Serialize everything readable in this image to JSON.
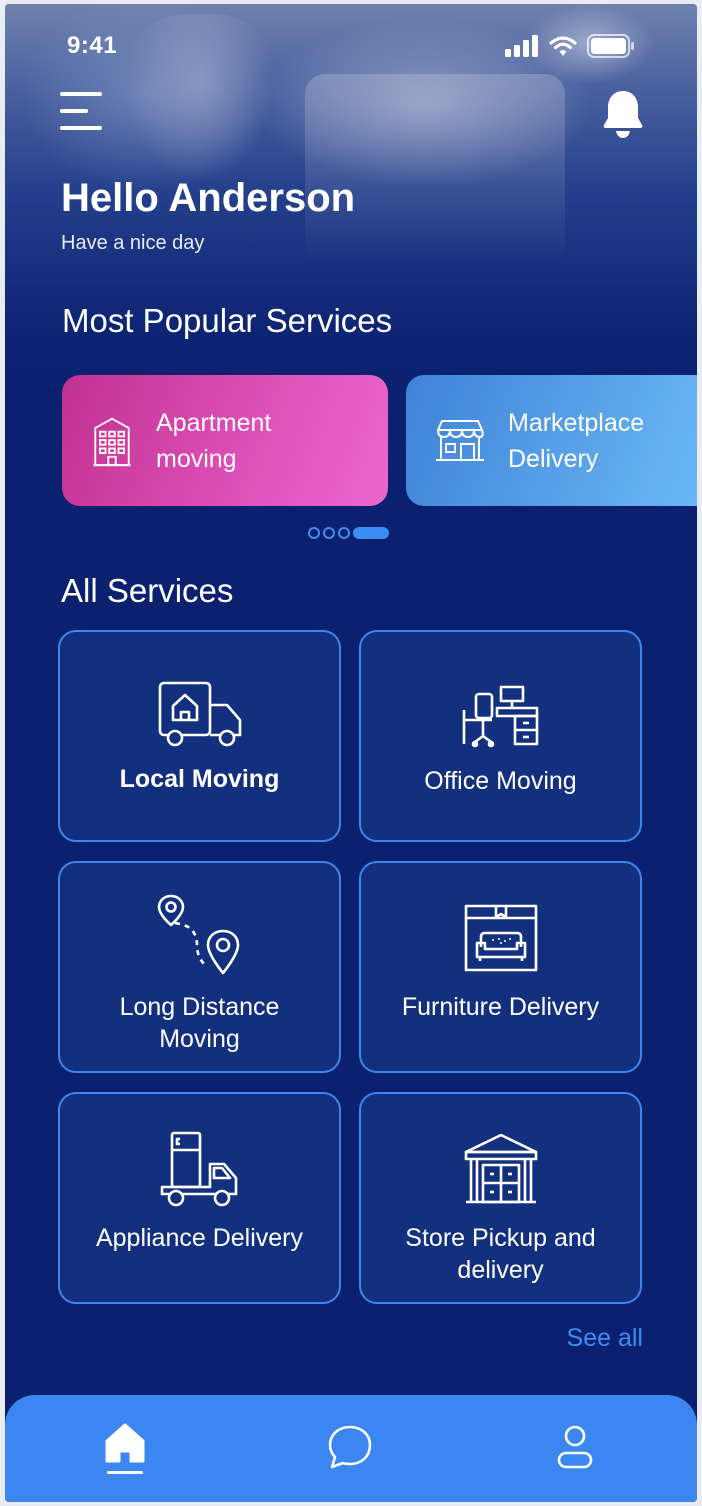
{
  "status_bar": {
    "time": "9:41"
  },
  "header": {
    "greeting": "Hello Anderson",
    "subtitle": "Have a nice day"
  },
  "popular": {
    "title": "Most Popular Services",
    "items": [
      {
        "line1": "Apartment",
        "line2": "moving",
        "icon": "building-icon"
      },
      {
        "line1": "Marketplace",
        "line2": "Delivery",
        "icon": "storefront-icon"
      }
    ],
    "carousel_pages": 4,
    "active_page": 4
  },
  "all_services": {
    "title": "All Services",
    "items": [
      {
        "label": "Local Moving",
        "icon": "moving-truck-house-icon"
      },
      {
        "label": "Office Moving",
        "icon": "office-desk-icon"
      },
      {
        "line1": "Long Distance",
        "line2": "Moving",
        "icon": "route-pins-icon"
      },
      {
        "label": "Furniture Delivery",
        "icon": "sofa-box-icon"
      },
      {
        "label": "Appliance Delivery",
        "icon": "fridge-truck-icon"
      },
      {
        "line1": "Store Pickup and",
        "line2": "delivery",
        "icon": "store-warehouse-icon"
      }
    ],
    "see_all": "See all"
  },
  "tabbar": {
    "tabs": [
      "home-icon",
      "chat-icon",
      "profile-icon"
    ],
    "active": "home-icon"
  },
  "colors": {
    "background": "#0b2170",
    "accent": "#3b86f0",
    "pink": "#dd4fb8"
  }
}
